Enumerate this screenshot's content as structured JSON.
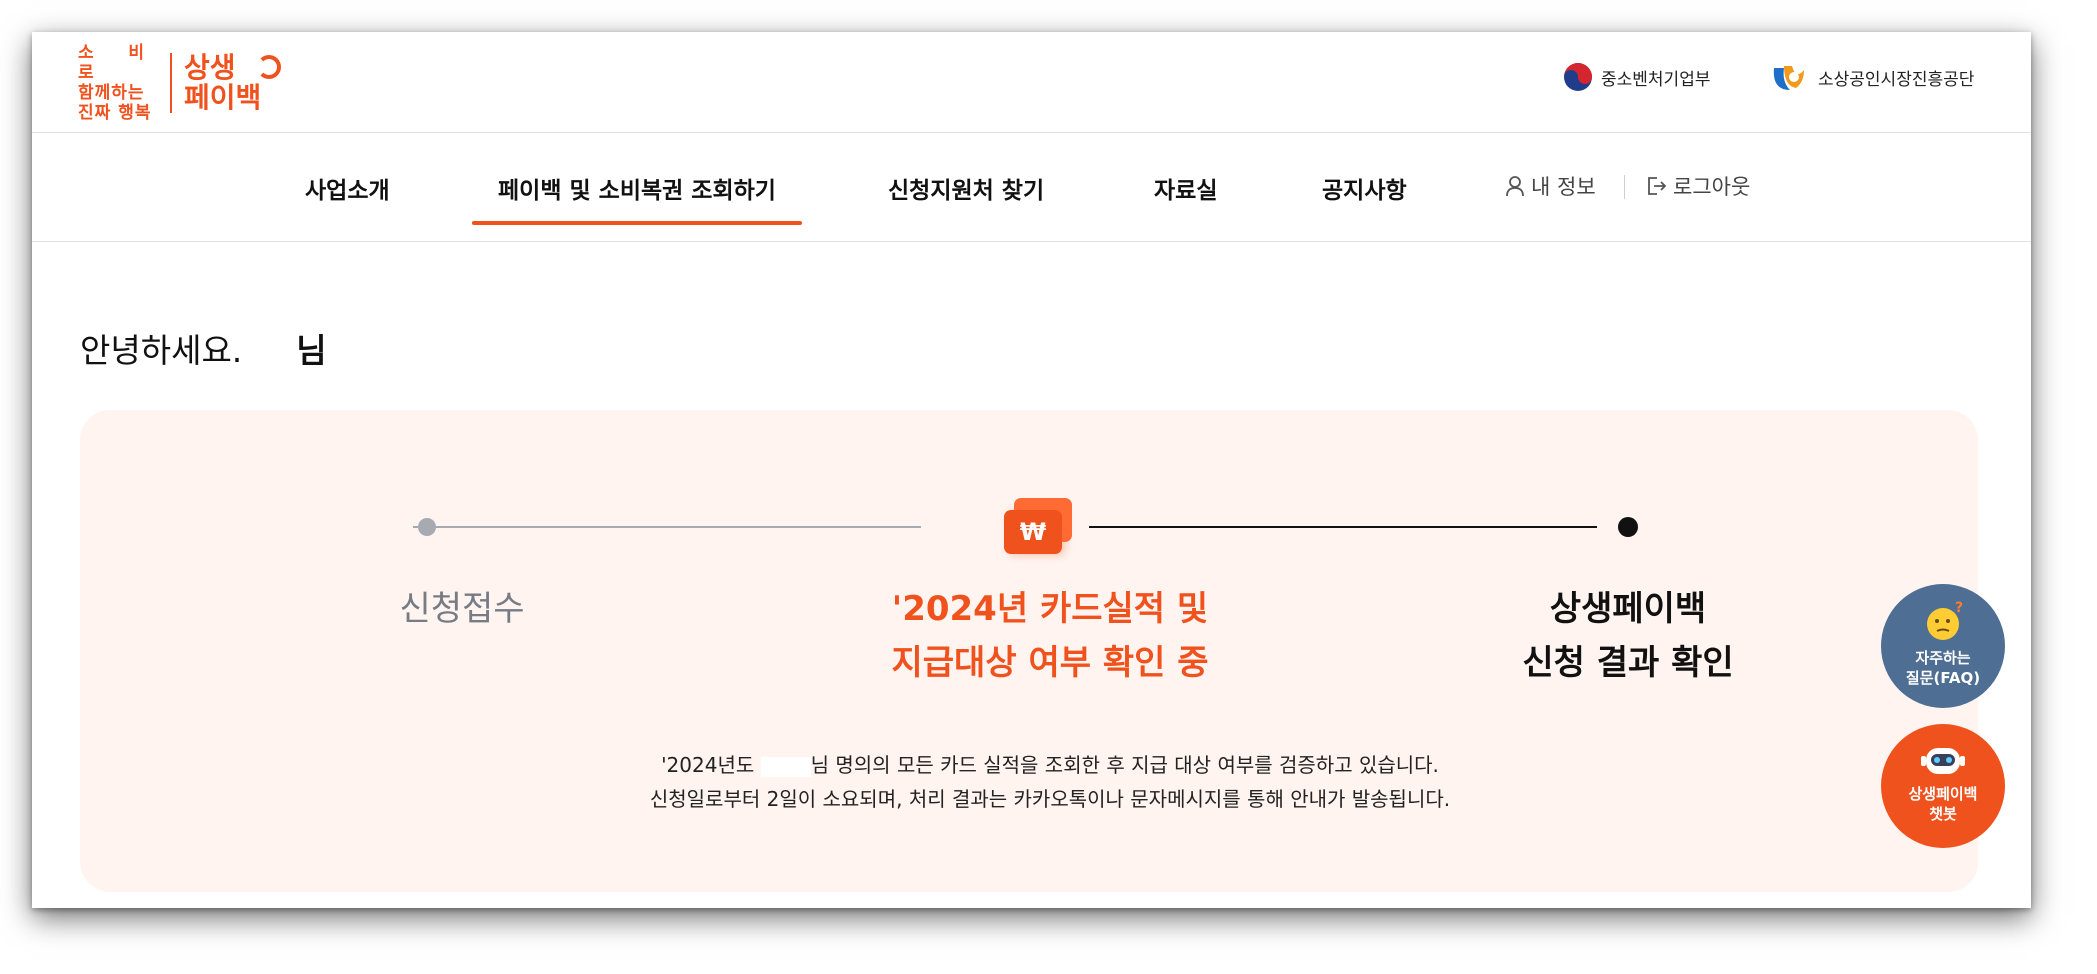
{
  "header": {
    "logo_slogan": [
      "소 비 로",
      "함께하는",
      "진짜 행복"
    ],
    "logo_mark": [
      "상생",
      "페이백"
    ],
    "org1": "중소벤처기업부",
    "org2": "소상공인시장진흥공단"
  },
  "nav": {
    "items": [
      "사업소개",
      "페이백 및 소비복권 조회하기",
      "신청지원처 찾기",
      "자료실",
      "공지사항"
    ],
    "active_index": 1,
    "my_info": "내 정보",
    "logout": "로그아웃"
  },
  "greeting": {
    "prefix": "안녕하세요.",
    "name_masked_tail": "님"
  },
  "status": {
    "steps": [
      {
        "line1": "신청접수",
        "line2": ""
      },
      {
        "line1": "'2024년 카드실적 및",
        "line2": "지급대상 여부 확인 중"
      },
      {
        "line1": "상생페이백",
        "line2": "신청 결과 확인"
      }
    ],
    "current_step": 2,
    "desc_part1": "'2024년도 ",
    "desc_part2": "님 명의의 모든 카드 실적을 조회한 후 지급 대상 여부를 검증하고 있습니다.",
    "desc_line2": "신청일로부터 2일이 소요되며, 처리 결과는 카카오톡이나 문자메시지를 통해 안내가 발송됩니다."
  },
  "floating": {
    "faq_line1": "자주하는",
    "faq_line2": "질문(FAQ)",
    "bot_line1": "상생페이백",
    "bot_line2": "챗봇"
  },
  "colors": {
    "accent": "#f0521e",
    "card_bg": "#fff4f0",
    "faq_button": "#4e6e93",
    "inactive_gray": "#a7aab0"
  }
}
